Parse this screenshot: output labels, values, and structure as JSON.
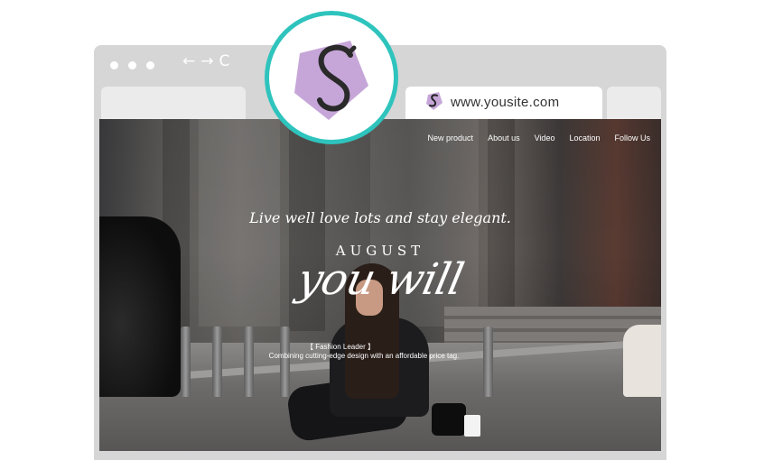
{
  "browser": {
    "nav_icons": [
      "back-arrow-icon",
      "forward-arrow-icon",
      "reload-icon"
    ],
    "nav_glyphs": {
      "back": "←",
      "forward": "→",
      "reload": "C"
    },
    "url": "www.yousite.com"
  },
  "site": {
    "nav": [
      "New product",
      "About us",
      "Video",
      "Location",
      "Follow Us"
    ],
    "tagline": "Live well love lots and stay elegant.",
    "month": "AUGUST",
    "script_title": "you will",
    "caption_title": "【 Fashion Leader 】",
    "caption_text": "Combining cutting-edge design with an affordable price tag."
  },
  "colors": {
    "accent_ring": "#2ec4bd",
    "logo_purple": "#c6a6d8",
    "browser_gray": "#d6d6d6"
  }
}
